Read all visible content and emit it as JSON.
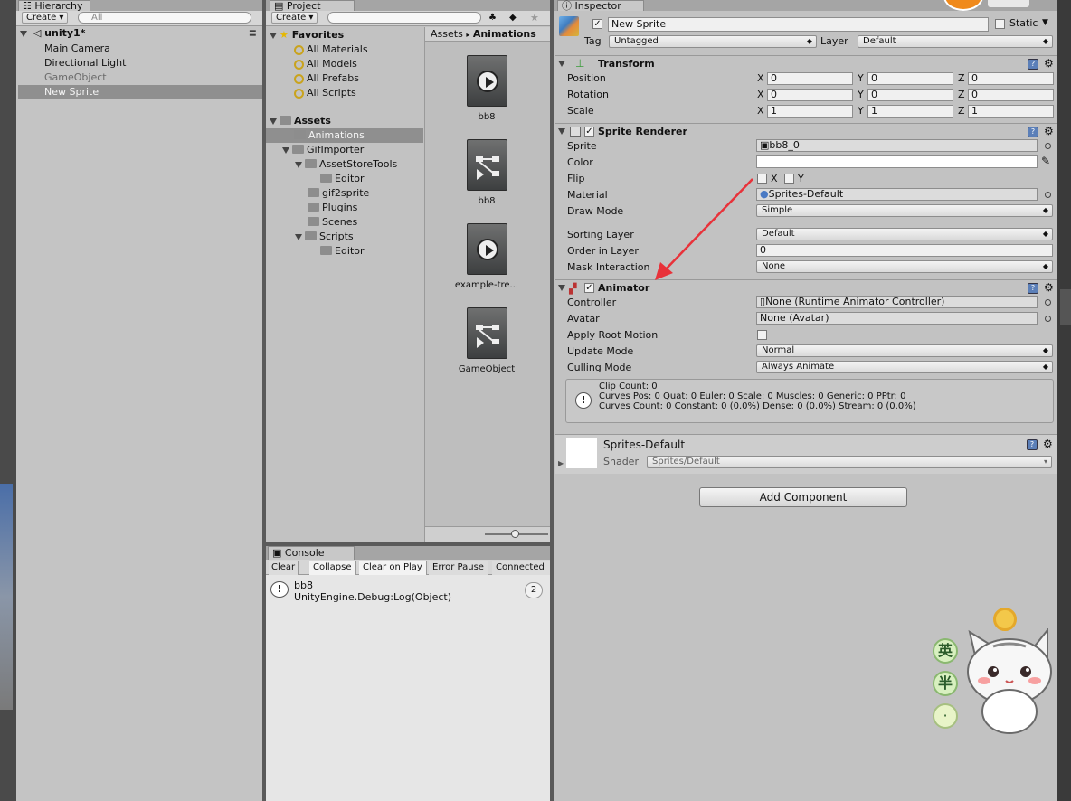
{
  "hierarchy": {
    "tab": "Hierarchy",
    "create_label": "Create ▾",
    "search_placeholder": "All",
    "scene_name": "unity1*",
    "items": [
      {
        "label": "Main Camera"
      },
      {
        "label": "Directional Light"
      },
      {
        "label": "GameObject"
      },
      {
        "label": "New Sprite"
      }
    ]
  },
  "project": {
    "tab": "Project",
    "create_label": "Create ▾",
    "favorites_label": "Favorites",
    "favorites": [
      "All Materials",
      "All Models",
      "All Prefabs",
      "All Scripts"
    ],
    "assets_label": "Assets",
    "tree": [
      "Animations",
      "GifImporter",
      "AssetStoreTools",
      "Editor",
      "gif2sprite",
      "Plugins",
      "Scenes",
      "Scripts",
      "Editor"
    ],
    "breadcrumb": {
      "root": "Assets",
      "sep": "▸",
      "current": "Animations"
    },
    "assets": [
      {
        "name": "bb8",
        "icon": "animation-clip-icon"
      },
      {
        "name": "bb8",
        "icon": "animator-controller-icon"
      },
      {
        "name": "example-tre...",
        "icon": "animation-clip-icon"
      },
      {
        "name": "GameObject",
        "icon": "animator-controller-icon"
      }
    ]
  },
  "console": {
    "tab": "Console",
    "buttons": [
      "Clear",
      "Collapse",
      "Clear on Play",
      "Error Pause",
      "Connected P"
    ],
    "entry": {
      "title": "bb8",
      "detail": "UnityEngine.Debug:Log(Object)",
      "count": "2"
    }
  },
  "inspector": {
    "tab": "Inspector",
    "object_name": "New Sprite",
    "static_label": "Static",
    "tag_label": "Tag",
    "tag_value": "Untagged",
    "layer_label": "Layer",
    "layer_value": "Default",
    "transform": {
      "title": "Transform",
      "rows": [
        {
          "label": "Position",
          "x": "0",
          "y": "0",
          "z": "0"
        },
        {
          "label": "Rotation",
          "x": "0",
          "y": "0",
          "z": "0"
        },
        {
          "label": "Scale",
          "x": "1",
          "y": "1",
          "z": "1"
        }
      ],
      "axis_x": "X",
      "axis_y": "Y",
      "axis_z": "Z"
    },
    "sprite_renderer": {
      "title": "Sprite Renderer",
      "sprite_label": "Sprite",
      "sprite_value": "bb8_0",
      "color_label": "Color",
      "flip_label": "Flip",
      "flip_x": "X",
      "flip_y": "Y",
      "material_label": "Material",
      "material_value": "Sprites-Default",
      "draw_mode_label": "Draw Mode",
      "draw_mode_value": "Simple",
      "sorting_layer_label": "Sorting Layer",
      "sorting_layer_value": "Default",
      "order_label": "Order in Layer",
      "order_value": "0",
      "mask_label": "Mask Interaction",
      "mask_value": "None"
    },
    "animator": {
      "title": "Animator",
      "controller_label": "Controller",
      "controller_value": "None (Runtime Animator Controller)",
      "avatar_label": "Avatar",
      "avatar_value": "None (Avatar)",
      "root_motion_label": "Apply Root Motion",
      "update_mode_label": "Update Mode",
      "update_mode_value": "Normal",
      "culling_label": "Culling Mode",
      "culling_value": "Always Animate",
      "info_line1": "Clip Count: 0",
      "info_line2": "Curves Pos: 0 Quat: 0 Euler: 0 Scale: 0 Muscles: 0 Generic: 0 PPtr: 0",
      "info_line3": "Curves Count: 0 Constant: 0 (0.0%) Dense: 0 (0.0%) Stream: 0 (0.0%)"
    },
    "material": {
      "name": "Sprites-Default",
      "shader_label": "Shader",
      "shader_value": "Sprites/Default"
    },
    "add_component_label": "Add Component"
  },
  "overlay": {
    "badge_chars": [
      "英",
      "半",
      "·"
    ],
    "annotation_color": "#e8323a"
  }
}
